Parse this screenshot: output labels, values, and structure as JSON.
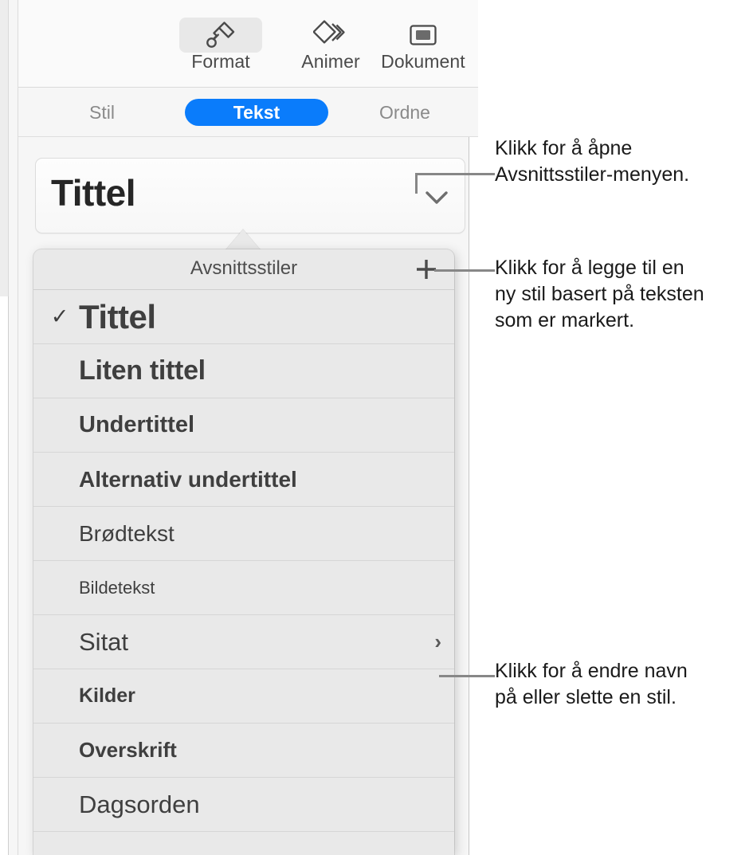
{
  "app": {
    "panel_name": "Format-inspektør"
  },
  "toolbar": {
    "items": [
      {
        "label": "Format",
        "icon": "paintbrush-icon",
        "active": true
      },
      {
        "label": "Animer",
        "icon": "animate-diamonds-icon",
        "active": false
      },
      {
        "label": "Dokument",
        "icon": "document-rectangle-icon",
        "active": false
      }
    ]
  },
  "tabs": {
    "items": [
      {
        "label": "Stil",
        "selected": false
      },
      {
        "label": "Tekst",
        "selected": true
      },
      {
        "label": "Ordne",
        "selected": false
      }
    ],
    "selected_color": "#0a7cfb"
  },
  "style_button": {
    "value": "Tittel",
    "chevron_icon": "chevron-down-icon"
  },
  "popup": {
    "title": "Avsnittsstiler",
    "add_icon": "plus-icon",
    "checkmark": "✓",
    "submenu_icon": "chevron-right-icon",
    "items": [
      {
        "label": "Tittel",
        "checked": true,
        "submenu": false
      },
      {
        "label": "Liten tittel",
        "checked": false,
        "submenu": false
      },
      {
        "label": "Undertittel",
        "checked": false,
        "submenu": false
      },
      {
        "label": "Alternativ undertittel",
        "checked": false,
        "submenu": false
      },
      {
        "label": "Brødtekst",
        "checked": false,
        "submenu": false
      },
      {
        "label": "Bildetekst",
        "checked": false,
        "submenu": false
      },
      {
        "label": "Sitat",
        "checked": false,
        "submenu": true
      },
      {
        "label": "Kilder",
        "checked": false,
        "submenu": false
      },
      {
        "label": "Overskrift",
        "checked": false,
        "submenu": false
      },
      {
        "label": "Dagsorden",
        "checked": false,
        "submenu": false
      }
    ]
  },
  "callouts": [
    {
      "text": "Klikk for å åpne\nAvsnittsstiler-menyen.",
      "target": "style-button-chevron"
    },
    {
      "text": "Klikk for å legge til en\nny stil basert på teksten\nsom er markert.",
      "target": "popup-add"
    },
    {
      "text": "Klikk for å endre navn\npå eller slette en stil.",
      "target": "menu-item-sitat-submenu"
    }
  ]
}
